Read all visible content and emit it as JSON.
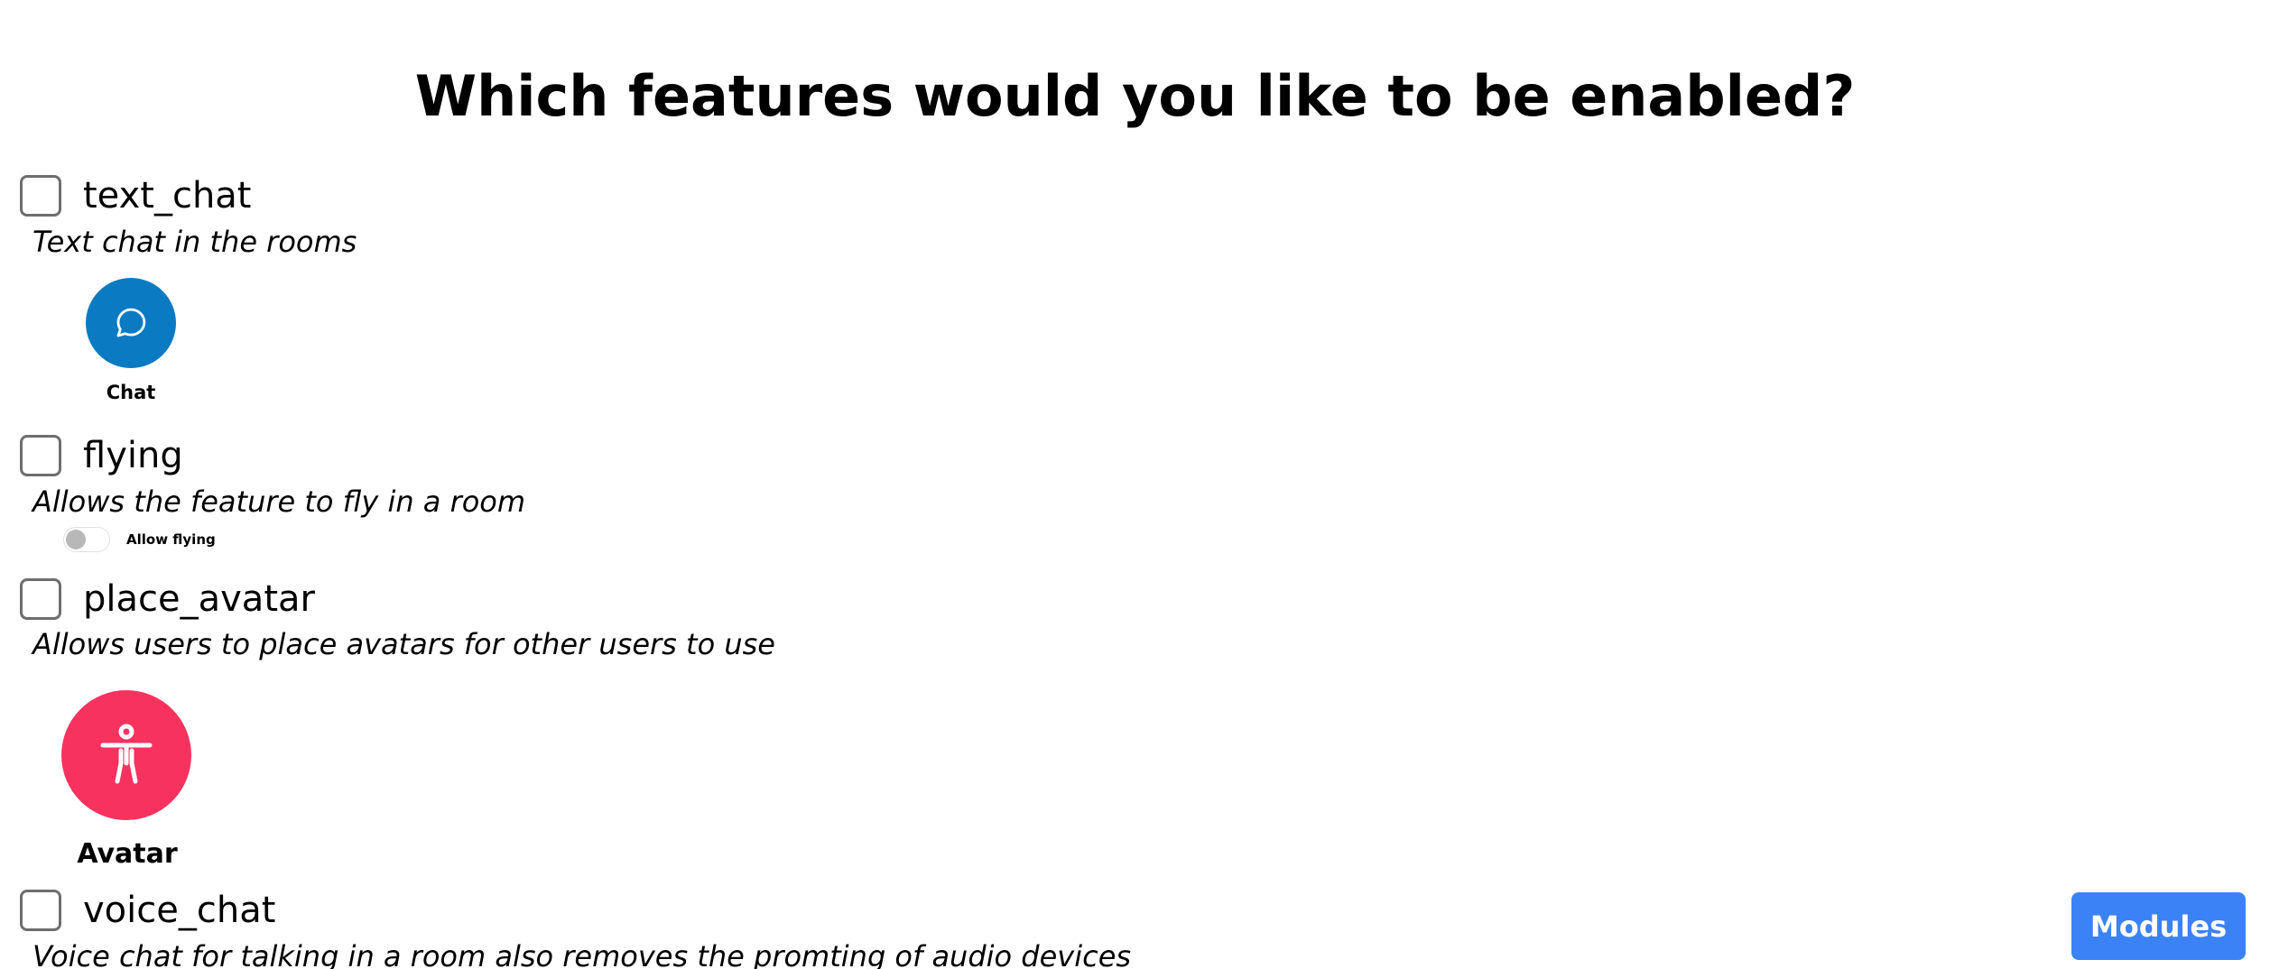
{
  "page": {
    "title": "Which features would you like to be enabled?"
  },
  "features": [
    {
      "name": "text_chat",
      "description": "Text chat in the rooms",
      "checked": false
    },
    {
      "name": "flying",
      "description": "Allows the feature to fly in a room",
      "checked": false
    },
    {
      "name": "place_avatar",
      "description": "Allows users to place avatars for other users to use",
      "checked": false
    },
    {
      "name": "voice_chat",
      "description": "Voice chat for talking in a room also removes the promting of audio devices",
      "checked": false
    }
  ],
  "previews": {
    "chat": {
      "label": "Chat",
      "icon": "chat-bubble-icon",
      "color": "#0a7bc2"
    },
    "flying": {
      "label": "Allow flying",
      "enabled": false
    },
    "avatar": {
      "label": "Avatar",
      "icon": "person-figure-icon",
      "color": "#f7325e"
    }
  },
  "actions": {
    "modules_label": "Modules",
    "accent": "#3b82f6"
  }
}
